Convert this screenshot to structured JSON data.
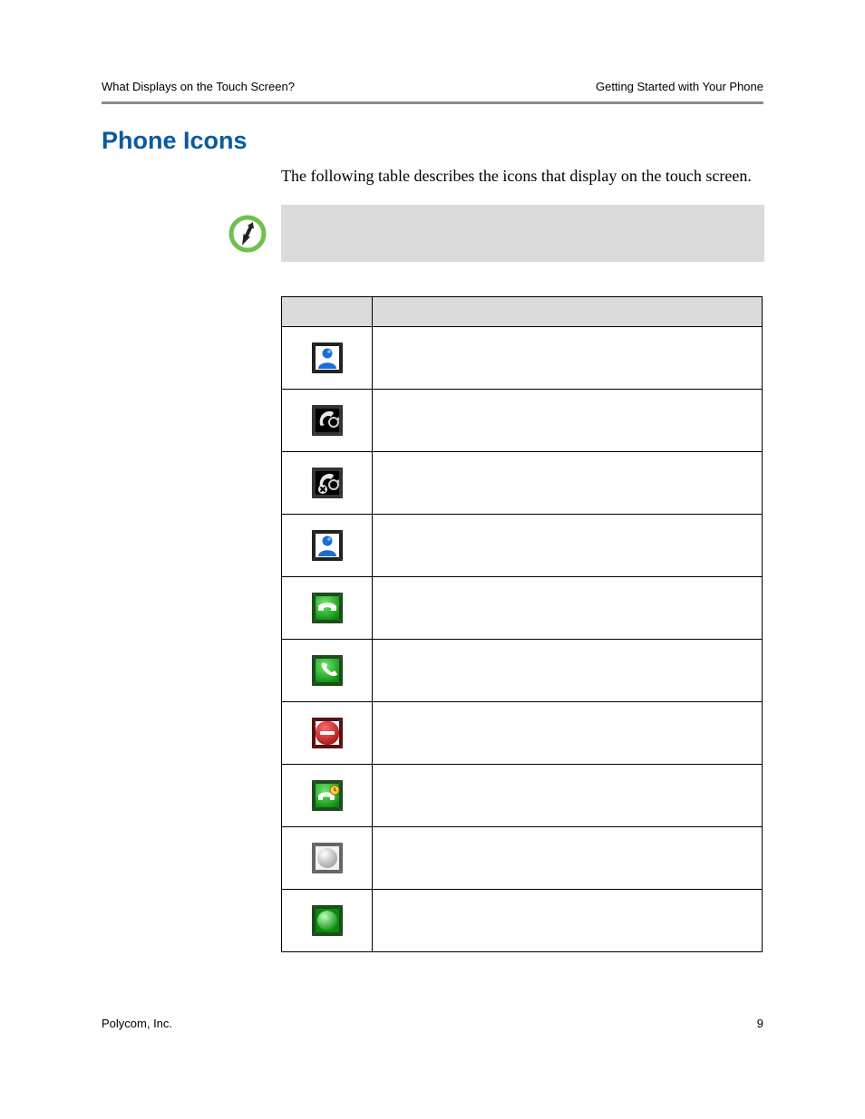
{
  "header": {
    "left": "What Displays on the Touch Screen?",
    "right": "Getting Started with Your Phone"
  },
  "section_title": "Phone Icons",
  "intro": "The following table describes the icons that display on the touch screen.",
  "callout": {
    "icon_name": "pushpin-icon",
    "text": ""
  },
  "table": {
    "columns": [
      "",
      ""
    ],
    "rows": [
      {
        "icon": "person-blue-icon",
        "description": ""
      },
      {
        "icon": "phone-roll-icon",
        "description": ""
      },
      {
        "icon": "phone-roll-x-icon",
        "description": ""
      },
      {
        "icon": "person-blue2-icon",
        "description": ""
      },
      {
        "icon": "handset-green-icon",
        "description": ""
      },
      {
        "icon": "handset-lift-icon",
        "description": ""
      },
      {
        "icon": "dnd-red-icon",
        "description": ""
      },
      {
        "icon": "forward-clock-icon",
        "description": ""
      },
      {
        "icon": "sphere-grey-icon",
        "description": ""
      },
      {
        "icon": "sphere-green-icon",
        "description": ""
      }
    ]
  },
  "footer": {
    "company": "Polycom, Inc.",
    "page": "9"
  }
}
